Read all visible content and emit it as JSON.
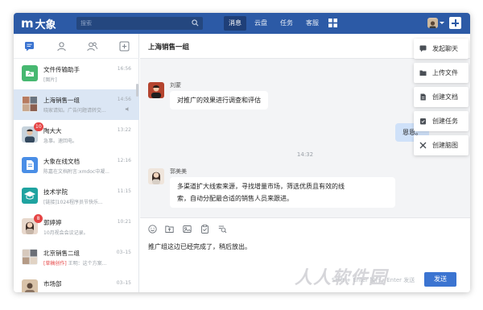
{
  "app": {
    "logo_text": "大象"
  },
  "search": {
    "placeholder": "搜索"
  },
  "nav": {
    "items": [
      "消息",
      "云盘",
      "任务",
      "客服"
    ]
  },
  "conversations": [
    {
      "title": "文件传输助手",
      "subtitle": "[图片]",
      "time": "16:56"
    },
    {
      "title": "上海销售一组",
      "subtitle": "晓家请知。广告问题请转交...",
      "time": "14:56"
    },
    {
      "title": "陶大大",
      "subtitle": "急事。速回电。",
      "time": "13:22",
      "badge": "10"
    },
    {
      "title": "大象在线文档",
      "subtitle": "陈嘉在文档附言:xmdoc中凝...",
      "time": "12:16"
    },
    {
      "title": "技术学院",
      "subtitle": "[链接]1024程序员节快乐...",
      "time": "11:15"
    },
    {
      "title": "郭婷婷",
      "subtitle": "10月视会会议记录。",
      "time": "10:21",
      "badge": "8"
    },
    {
      "title": "北京销售二组",
      "subtitle_tag": "[草稿创作]",
      "subtitle": "王明：这个方案...",
      "time": "03–15"
    },
    {
      "title": "市场部",
      "subtitle": "",
      "time": "03–15"
    }
  ],
  "chat": {
    "title": "上海销售一组",
    "messages": [
      {
        "sender": "刘蒙",
        "text": "对推广的效果进行调查和评估"
      },
      {
        "sender": "me",
        "text": "恩恩。"
      },
      {
        "sender": "郭美美",
        "text_line1": "多渠道扩大线索来源，寻找增量市场，筛选优质且有效的线",
        "text_line2": "索，自动分配最合适的销售人员来跟进。"
      }
    ],
    "timestamp": "14:32",
    "composer_text": "推广组这边已经完成了，稍后放出。",
    "hint": "Shift + Enter 换行，Enter 发送",
    "send_label": "发送"
  },
  "menu": {
    "items": [
      "发起聊天",
      "上传文件",
      "创建文档",
      "创建任务",
      "创建脑图"
    ]
  },
  "watermark": "人人软件园",
  "colors": {
    "brand": "#2c5aa6",
    "active_row": "#dbe6f4",
    "my_bubble": "#cfe1f9",
    "badge": "#e54545"
  }
}
